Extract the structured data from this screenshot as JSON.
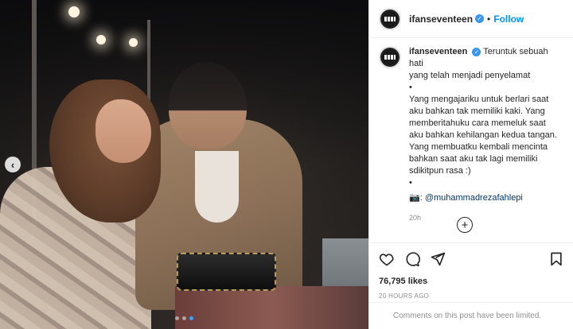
{
  "post": {
    "username": "ifanseventeen",
    "separator": "•",
    "follow_label": "Follow",
    "carousel": {
      "total": 3,
      "active_index": 2,
      "prev_icon": "chevron-left-icon"
    },
    "caption": {
      "lines": [
        "Teruntuk sebuah hati",
        "yang telah menjadi penyelamat",
        "•",
        "Yang mengajariku untuk berlari saat",
        "aku bahkan tak memiliki kaki. Yang",
        "memberitahuku cara memeluk saat",
        "aku bahkan kehilangan kedua tangan.",
        "Yang membuatku kembali mencinta",
        "bahkan saat aku tak lagi memiliki",
        "sdikitpun rasa :)",
        "•"
      ],
      "camera_emoji": "📷",
      "mention": ": @muhammadrezafahlepi",
      "time": "20h"
    },
    "load_more_icon": "plus-circle-icon",
    "likes": "76,795 likes",
    "posted_ago": "20 HOURS AGO",
    "comments_notice": "Comments on this post have been limited.",
    "icons": [
      "heart-icon",
      "comment-icon",
      "share-icon",
      "bookmark-icon"
    ],
    "colors": {
      "accent": "#0095f6",
      "verified": "#3897f0",
      "active_dot": "#3ea1ff"
    }
  }
}
